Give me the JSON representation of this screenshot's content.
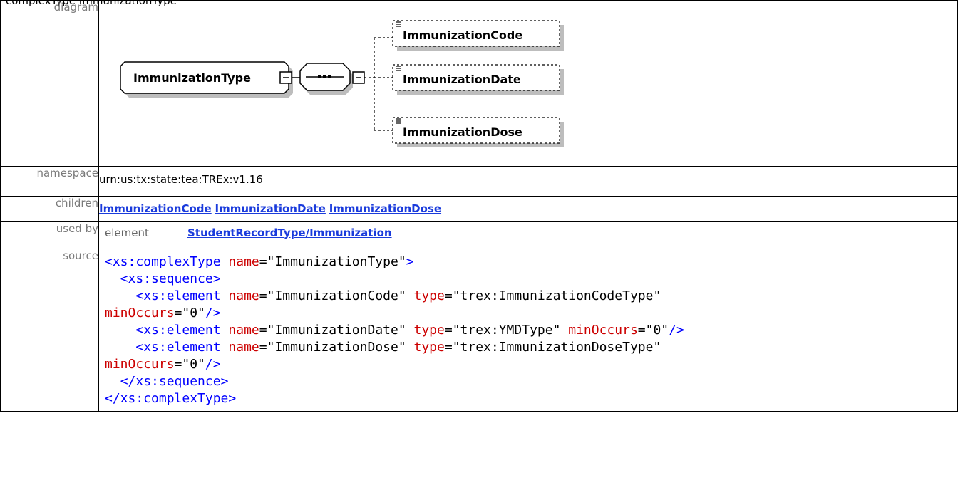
{
  "header": {
    "partial_title": "complexType ImmunizationType"
  },
  "rows": {
    "diagram": {
      "label": "diagram"
    },
    "namespace": {
      "label": "namespace",
      "value": "urn:us:tx:state:tea:TREx:v1.16"
    },
    "children": {
      "label": "children",
      "items": [
        "ImmunizationCode",
        "ImmunizationDate",
        "ImmunizationDose"
      ]
    },
    "used_by": {
      "label": "used by",
      "kind": "element",
      "link": "StudentRecordType/Immunization"
    },
    "source": {
      "label": "source"
    }
  },
  "diagram": {
    "type_name": "ImmunizationType",
    "children": [
      "ImmunizationCode",
      "ImmunizationDate",
      "ImmunizationDose"
    ]
  },
  "source_code": {
    "line1": [
      "<xs:complexType",
      " name",
      "=\"ImmunizationType\"",
      ">"
    ],
    "line2": [
      "<xs:sequence>"
    ],
    "line3": [
      "<xs:element",
      " name",
      "=\"ImmunizationCode\"",
      " type",
      "=\"trex:ImmunizationCodeType\""
    ],
    "line4": [
      "minOccurs",
      "=\"0\"",
      "/>"
    ],
    "line5": [
      "<xs:element",
      " name",
      "=\"ImmunizationDate\"",
      " type",
      "=\"trex:YMDType\"",
      " minOccurs",
      "=\"0\"",
      "/>"
    ],
    "line6": [
      "<xs:element",
      " name",
      "=\"ImmunizationDose\"",
      " type",
      "=\"trex:ImmunizationDoseType\""
    ],
    "line7": [
      "minOccurs",
      "=\"0\"",
      "/>"
    ],
    "line8": [
      "</xs:sequence>"
    ],
    "line9": [
      "</xs:complexType>"
    ]
  },
  "colors": {
    "tag": "#0000ff",
    "attr": "#cc0000",
    "link": "#1a3bdc",
    "label": "#7a7a7a"
  }
}
